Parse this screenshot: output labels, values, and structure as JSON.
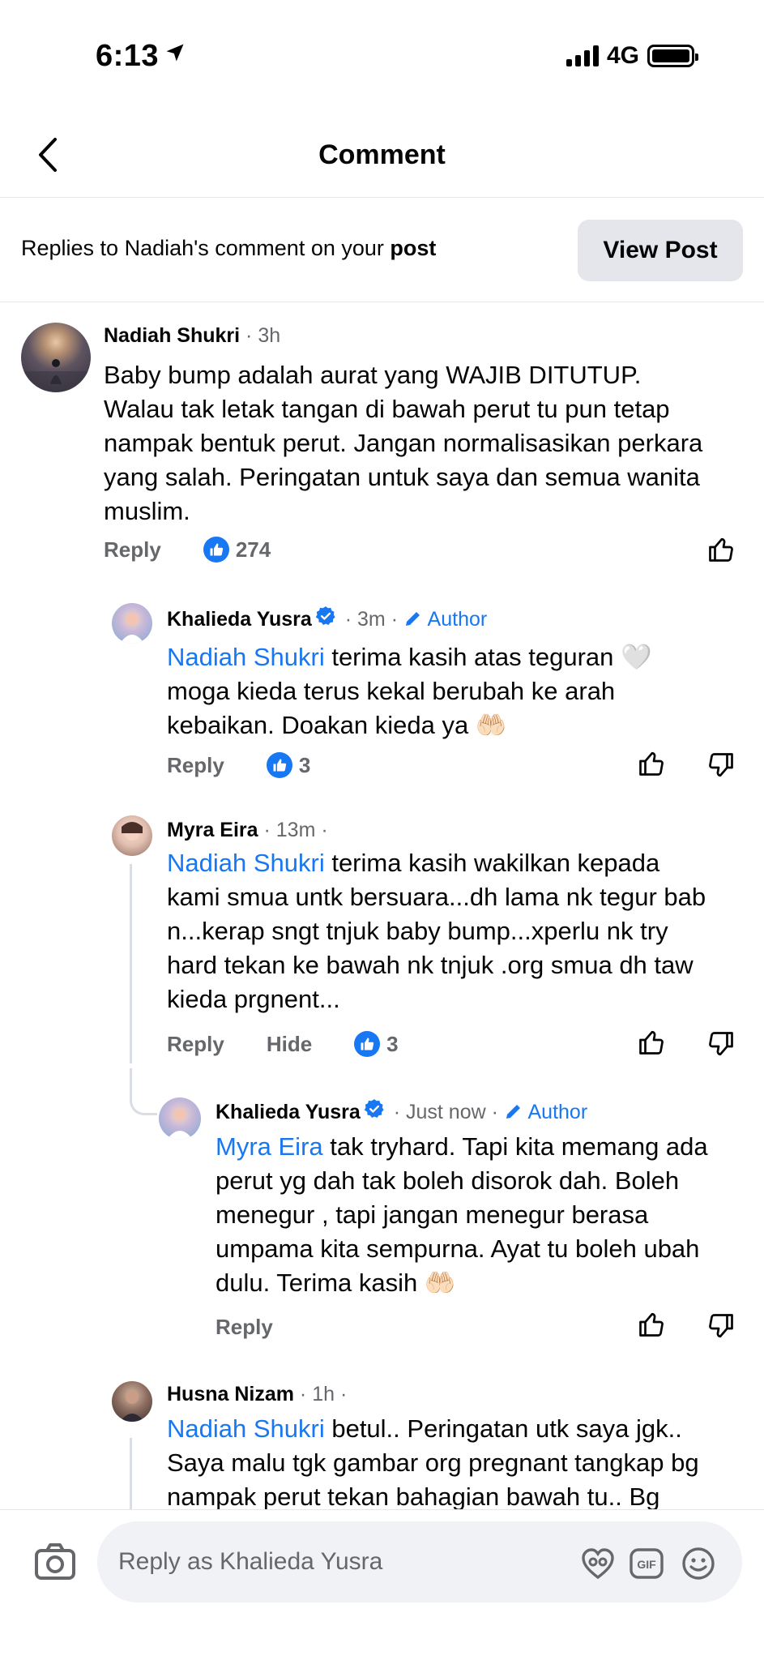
{
  "status": {
    "time": "6:13",
    "network": "4G"
  },
  "header": {
    "title": "Comment"
  },
  "replies_bar": {
    "text_prefix": "Replies to Nadiah's comment on your ",
    "text_bold": "post",
    "view_post_label": "View Post"
  },
  "comments": [
    {
      "name": "Nadiah Shukri",
      "time": "3h",
      "lines": [
        "Baby bump adalah aurat yang WAJIB DITUTUP.",
        "Walau tak letak tangan di bawah perut tu pun tetap",
        "nampak bentuk perut. Jangan normalisasikan perkara",
        "yang salah. Peringatan untuk saya dan semua wanita",
        "muslim."
      ],
      "reply_label": "Reply",
      "like_count": "274"
    },
    {
      "name": "Khalieda Yusra",
      "time": "3m",
      "author_label": "Author",
      "mention": "Nadiah Shukri",
      "line1_rest": " terima kasih atas teguran 🤍",
      "lines": [
        "moga kieda terus kekal berubah ke arah",
        "kebaikan. Doakan kieda ya 🤲🏻"
      ],
      "reply_label": "Reply",
      "like_count": "3"
    },
    {
      "name": "Myra Eira",
      "time": "13m",
      "mention": "Nadiah Shukri",
      "line1_rest": " terima kasih wakilkan kepada",
      "lines": [
        "kami smua untk bersuara...dh lama nk tegur bab",
        "n...kerap sngt tnjuk baby bump...xperlu nk try",
        "hard tekan ke bawah nk tnjuk .org smua dh taw",
        "kieda prgnent..."
      ],
      "reply_label": "Reply",
      "hide_label": "Hide",
      "like_count": "3"
    },
    {
      "name": "Khalieda Yusra",
      "time": "Just now",
      "author_label": "Author",
      "mention": "Myra Eira",
      "line1_rest": " tak tryhard. Tapi kita memang ada",
      "lines": [
        "perut yg dah tak boleh disorok dah. Boleh",
        "menegur , tapi jangan menegur berasa",
        "umpama kita sempurna. Ayat tu boleh ubah",
        "dulu. Terima kasih 🤲🏻"
      ],
      "reply_label": "Reply"
    },
    {
      "name": "Husna Nizam",
      "time": "1h",
      "mention": "Nadiah Shukri",
      "line1_rest": " betul.. Peringatan utk saya jgk..",
      "lines": [
        "Saya malu tgk gambar org pregnant tangkap bg",
        "nampak perut tekan bahagian bawah tu.. Bg"
      ]
    }
  ],
  "bottom_bar": {
    "input_placeholder": "Reply as Khalieda Yusra"
  },
  "colors": {
    "accent": "#1877f2",
    "meta": "#65676b",
    "button_bg": "#e4e6eb",
    "input_bg": "#f0f2f5"
  }
}
